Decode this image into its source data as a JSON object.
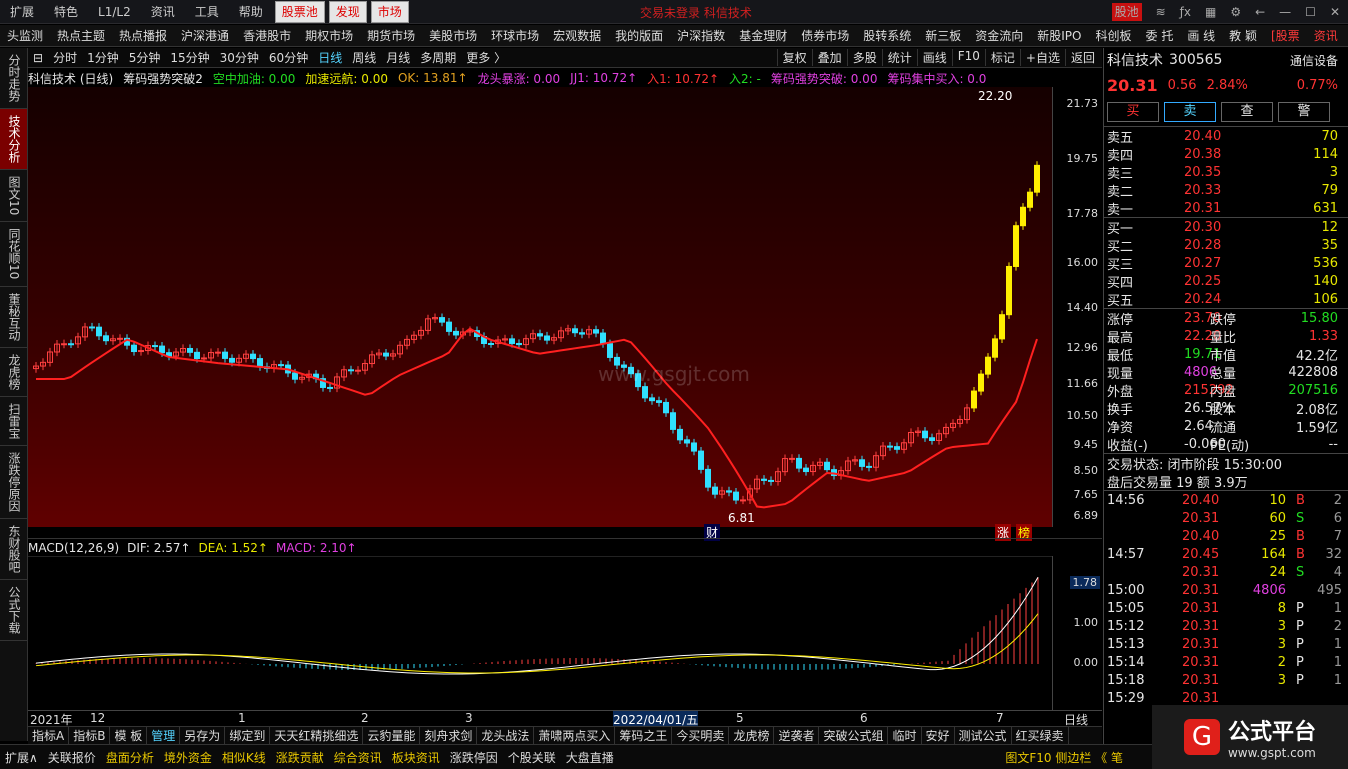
{
  "topmenu": {
    "items": [
      "扩展",
      "特色",
      "L1/L2",
      "资讯",
      "工具",
      "帮助"
    ],
    "tabs": [
      "股票池",
      "发现",
      "市场"
    ],
    "title": "交易未登录 科信技术",
    "right": [
      "股池"
    ]
  },
  "navbar": {
    "items": [
      "头监测",
      "热点主题",
      "热点播报",
      "沪深港通",
      "香港股市",
      "期权市场",
      "期货市场",
      "美股市场",
      "环球市场",
      "宏观数据",
      "我的版面",
      "沪深指数",
      "基金理财",
      "债券市场",
      "股转系统",
      "新三板",
      "资金流向",
      "新股IPO",
      "科创板",
      "委 托",
      "画 线",
      "教 颖",
      "[股票",
      "资讯"
    ]
  },
  "side": [
    "分时走势",
    "技术分析",
    "图文10",
    "同花顺10",
    "董秘互动",
    "龙虎榜",
    "扫雷宝",
    "涨跌停原因",
    "东财股吧",
    "公式下载"
  ],
  "periodbar": {
    "items": [
      "分时",
      "1分钟",
      "5分钟",
      "15分钟",
      "30分钟",
      "60分钟",
      "日线",
      "周线",
      "月线",
      "多周期",
      "更多 〉"
    ],
    "tools": [
      "复权",
      "叠加",
      "多股",
      "统计",
      "画线",
      "F10",
      "标记",
      "+自选",
      "返回"
    ]
  },
  "info": {
    "stock": "科信技术 (日线)",
    "formula": "筹码强势突破2",
    "kongzhong": "空中加油: 0.00",
    "jiasu": "加速远航: 0.00",
    "ok": "OK: 13.81↑",
    "longtou": "龙头暴涨: 0.00",
    "jj1": "JJ1: 10.72↑",
    "ru1": "入1: 10.72↑",
    "ru2": "入2: -",
    "choumaqs": "筹码强势突破: 0.00",
    "choumajz": "筹码集中买入: 0.0"
  },
  "chart": {
    "scale": [
      "21.73",
      "19.75",
      "17.78",
      "16.00",
      "14.40",
      "12.96",
      "11.66",
      "10.50",
      "9.45",
      "8.50",
      "7.65",
      "6.89"
    ],
    "high": "22.20",
    "low": "6.81",
    "watermark": "www.gsgjt.com",
    "zhang": "涨",
    "bang": "榜",
    "cai": "财"
  },
  "macd": {
    "title": "MACD(12,26,9)",
    "dif": "DIF: 2.57↑",
    "dea": "DEA: 1.52↑",
    "macd": "MACD: 2.10↑",
    "scale": [
      "1.78",
      "1.00",
      "0.00"
    ]
  },
  "xaxis": {
    "labels": [
      "2021年",
      "12",
      "1",
      "2",
      "3",
      "2022/04/01/五",
      "5",
      "6",
      "7"
    ],
    "right": "日线"
  },
  "idxbar": [
    "指标A",
    "指标B",
    "模 板",
    "管理",
    "另存为",
    "绑定到",
    "天天红精挑细选",
    "云豹量能",
    "刻舟求剑",
    "龙头战法",
    "萧啸两点买入",
    "筹码之王",
    "今买明卖",
    "龙虎榜",
    "逆袭者",
    "突破公式组",
    "临时",
    "安好",
    "测试公式",
    "红买绿卖"
  ],
  "bottombar": {
    "items": [
      "扩展∧",
      "关联报价",
      "盘面分析",
      "境外资金",
      "相似K线",
      "涨跌贡献",
      "综合资讯",
      "板块资讯",
      "涨跌停因",
      "个股关联",
      "大盘直播"
    ],
    "right": "图文F10 侧边栏 《 笔"
  },
  "quote": {
    "name": "科信技术",
    "code": "300565",
    "tag": "通信设备",
    "price": "20.31",
    "chg": "0.56",
    "pct": "2.84%",
    "pct2": "0.77%",
    "buttons": [
      "买",
      "卖",
      "查",
      "警"
    ],
    "asks": [
      [
        "卖五",
        "20.40",
        "70"
      ],
      [
        "卖四",
        "20.38",
        "114"
      ],
      [
        "卖三",
        "20.35",
        "3"
      ],
      [
        "卖二",
        "20.33",
        "79"
      ],
      [
        "卖一",
        "20.31",
        "631"
      ]
    ],
    "bids": [
      [
        "买一",
        "20.30",
        "12"
      ],
      [
        "买二",
        "20.28",
        "35"
      ],
      [
        "买三",
        "20.27",
        "536"
      ],
      [
        "买四",
        "20.25",
        "140"
      ],
      [
        "买五",
        "20.24",
        "106"
      ]
    ],
    "stats": [
      [
        "涨停",
        "23.70",
        "跌停",
        "15.80"
      ],
      [
        "最高",
        "22.20",
        "量比",
        "1.33"
      ],
      [
        "最低",
        "19.71",
        "市值",
        "42.2亿"
      ],
      [
        "现量",
        "4806",
        "总量",
        "422808"
      ],
      [
        "外盘",
        "215292",
        "内盘",
        "207516"
      ],
      [
        "换手",
        "26.57%",
        "股本",
        "2.08亿"
      ],
      [
        "净资",
        "2.64",
        "流通",
        "1.59亿"
      ],
      [
        "收益(-)",
        "-0.060",
        "PE(动)",
        "--"
      ]
    ],
    "status": "交易状态: 闭市阶段 15:30:00",
    "after": "盘后交易量 19 额 3.9万",
    "ticks": [
      [
        "14:56",
        "20.40",
        "10",
        "B",
        "2"
      ],
      [
        "",
        "20.31",
        "60",
        "S",
        "6"
      ],
      [
        "",
        "20.40",
        "25",
        "B",
        "7"
      ],
      [
        "14:57",
        "20.45",
        "164",
        "B",
        "32"
      ],
      [
        "",
        "20.31",
        "24",
        "S",
        "4"
      ],
      [
        "15:00",
        "20.31",
        "4806",
        "",
        "495"
      ],
      [
        "15:05",
        "20.31",
        "8",
        "P",
        "1"
      ],
      [
        "15:12",
        "20.31",
        "3",
        "P",
        "2"
      ],
      [
        "15:13",
        "20.31",
        "3",
        "P",
        "1"
      ],
      [
        "15:14",
        "20.31",
        "2",
        "P",
        "1"
      ],
      [
        "15:18",
        "20.31",
        "3",
        "P",
        "1"
      ],
      [
        "15:29",
        "20.31",
        "",
        "",
        ""
      ]
    ]
  },
  "logo": {
    "text": "公式平台",
    "url": "www.gspt.com"
  },
  "chart_data": {
    "type": "candlestick",
    "ylim": [
      6.81,
      22.2
    ],
    "high": 22.2,
    "low": 6.81,
    "last": 20.31
  }
}
